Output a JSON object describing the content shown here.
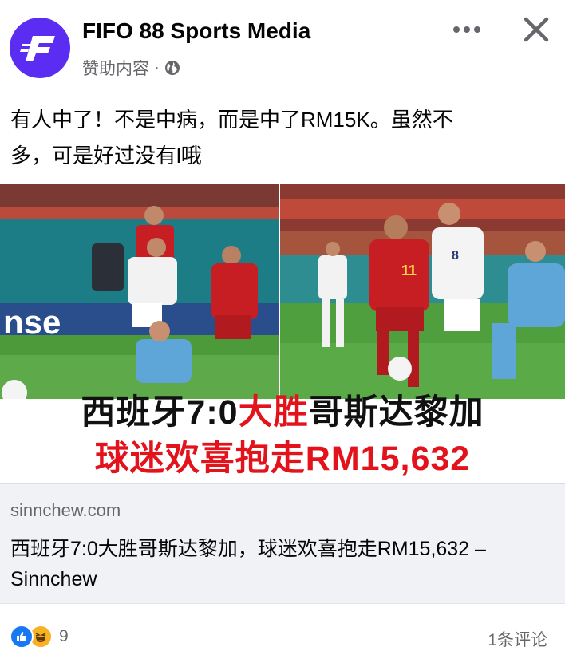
{
  "post": {
    "page_name": "FIFO 88 Sports Media",
    "sponsored_label": "赞助内容",
    "separator": "·",
    "text_line1": "有人中了！不是中病，而是中了RM15K。虽然不",
    "text_line2": "多，可是好过没有l哦"
  },
  "media": {
    "headline_part1": "西班牙7:0",
    "headline_part2": "大胜",
    "headline_part3": "哥斯达黎加",
    "headline_line2": "球迷欢喜抱走RM15,632",
    "banner_text": "nse",
    "jersey_left": "8",
    "jersey_right": "11"
  },
  "link": {
    "domain": "sinnchew.com",
    "title": "西班牙7:0大胜哥斯达黎加，球迷欢喜抱走RM15,632 – Sinnchew"
  },
  "footer": {
    "reaction_count": "9",
    "comments": "1条评论"
  },
  "colors": {
    "brand": "#5b2df2",
    "accent_red": "#e3131c",
    "like_blue": "#1877f2"
  },
  "icons": {
    "avatar": "fifo-logo-icon",
    "globe": "globe-icon",
    "more": "more-icon",
    "close": "close-icon",
    "like": "like-icon",
    "haha": "haha-icon"
  }
}
